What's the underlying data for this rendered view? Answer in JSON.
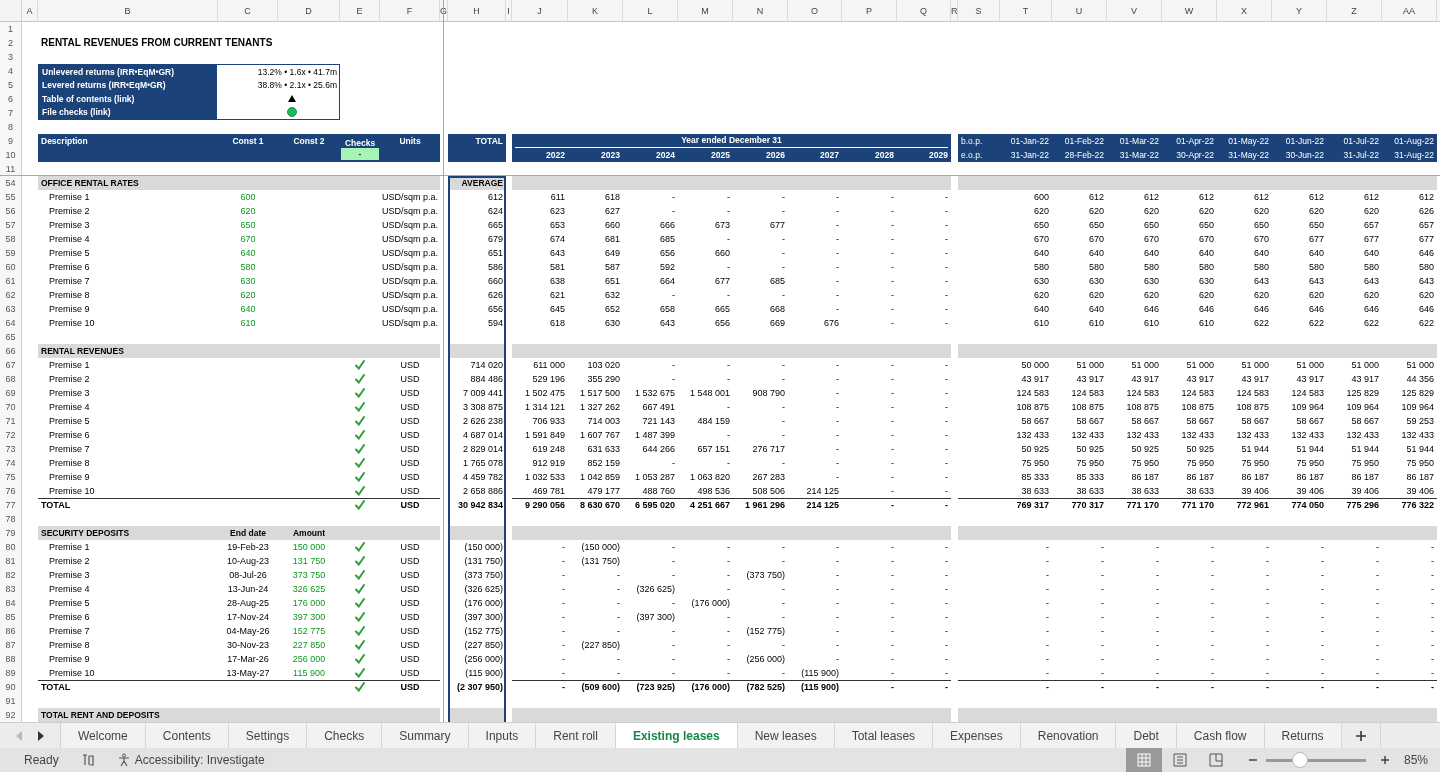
{
  "column_headers": [
    "A",
    "B",
    "C",
    "D",
    "E",
    "F",
    "G",
    "H",
    "I",
    "J",
    "K",
    "L",
    "M",
    "N",
    "O",
    "P",
    "Q",
    "R",
    "S",
    "T",
    "U",
    "V",
    "W",
    "X",
    "Y",
    "Z",
    "AA"
  ],
  "row_numbers": [
    "1",
    "2",
    "3",
    "4",
    "5",
    "6",
    "7",
    "8",
    "9",
    "10",
    "11",
    "54",
    "55",
    "56",
    "57",
    "58",
    "59",
    "60",
    "61",
    "62",
    "63",
    "64",
    "65",
    "66",
    "67",
    "68",
    "69",
    "70",
    "71",
    "72",
    "73",
    "74",
    "75",
    "76",
    "77",
    "78",
    "79",
    "80",
    "81",
    "82",
    "83",
    "84",
    "85",
    "86",
    "87",
    "88",
    "89",
    "90",
    "91",
    "92"
  ],
  "title": "RENTAL REVENUES FROM CURRENT TENANTS",
  "summary_box": [
    {
      "label": "Unlevered returns (IRR•EqM•GR)",
      "kind": "text",
      "value": "13.2% • 1.6x • 41.7m"
    },
    {
      "label": "Levered returns (IRR•EqM•GR)",
      "kind": "text",
      "value": "38.8% • 2.1x • 25.6m"
    },
    {
      "label": "Table of contents (link)",
      "kind": "link"
    },
    {
      "label": "File checks (link)",
      "kind": "status",
      "color": "#1fb85a"
    }
  ],
  "header": {
    "description": "Description",
    "const_1": "Const 1",
    "const_2": "Const 2",
    "checks": "Checks",
    "checks_value": "-",
    "units": "Units",
    "total": "TOTAL",
    "period_title": "Year ended December 31",
    "years": [
      "2022",
      "2023",
      "2024",
      "2025",
      "2026",
      "2027",
      "2028",
      "2029"
    ],
    "bop_label": "b.o.p.",
    "eop_label": "e.o.p.",
    "bop_dates": [
      "01-Jan-22",
      "01-Feb-22",
      "01-Mar-22",
      "01-Apr-22",
      "01-May-22",
      "01-Jun-22",
      "01-Jul-22",
      "01-Aug-22"
    ],
    "eop_dates": [
      "31-Jan-22",
      "28-Feb-22",
      "31-Mar-22",
      "30-Apr-22",
      "31-May-22",
      "30-Jun-22",
      "31-Jul-22",
      "31-Aug-22"
    ]
  },
  "sections": [
    {
      "title": "OFFICE RENTAL RATES",
      "total_heading": "AVERAGE",
      "rows": [
        {
          "label": "Premise 1",
          "rate": "600",
          "units": "USD/sqm p.a.",
          "total": "612",
          "years": [
            "611",
            "618",
            "-",
            "-",
            "-",
            "-",
            "-",
            "-"
          ],
          "months": [
            "600",
            "612",
            "612",
            "612",
            "612",
            "612",
            "612",
            "612"
          ]
        },
        {
          "label": "Premise 2",
          "rate": "620",
          "units": "USD/sqm p.a.",
          "total": "624",
          "years": [
            "623",
            "627",
            "-",
            "-",
            "-",
            "-",
            "-",
            "-"
          ],
          "months": [
            "620",
            "620",
            "620",
            "620",
            "620",
            "620",
            "620",
            "626"
          ]
        },
        {
          "label": "Premise 3",
          "rate": "650",
          "units": "USD/sqm p.a.",
          "total": "665",
          "years": [
            "653",
            "660",
            "666",
            "673",
            "677",
            "-",
            "-",
            "-"
          ],
          "months": [
            "650",
            "650",
            "650",
            "650",
            "650",
            "650",
            "657",
            "657"
          ]
        },
        {
          "label": "Premise 4",
          "rate": "670",
          "units": "USD/sqm p.a.",
          "total": "679",
          "years": [
            "674",
            "681",
            "685",
            "-",
            "-",
            "-",
            "-",
            "-"
          ],
          "months": [
            "670",
            "670",
            "670",
            "670",
            "670",
            "677",
            "677",
            "677"
          ]
        },
        {
          "label": "Premise 5",
          "rate": "640",
          "units": "USD/sqm p.a.",
          "total": "651",
          "years": [
            "643",
            "649",
            "656",
            "660",
            "-",
            "-",
            "-",
            "-"
          ],
          "months": [
            "640",
            "640",
            "640",
            "640",
            "640",
            "640",
            "640",
            "646"
          ]
        },
        {
          "label": "Premise 6",
          "rate": "580",
          "units": "USD/sqm p.a.",
          "total": "586",
          "years": [
            "581",
            "587",
            "592",
            "-",
            "-",
            "-",
            "-",
            "-"
          ],
          "months": [
            "580",
            "580",
            "580",
            "580",
            "580",
            "580",
            "580",
            "580"
          ]
        },
        {
          "label": "Premise 7",
          "rate": "630",
          "units": "USD/sqm p.a.",
          "total": "660",
          "years": [
            "638",
            "651",
            "664",
            "677",
            "685",
            "-",
            "-",
            "-"
          ],
          "months": [
            "630",
            "630",
            "630",
            "630",
            "643",
            "643",
            "643",
            "643"
          ]
        },
        {
          "label": "Premise 8",
          "rate": "620",
          "units": "USD/sqm p.a.",
          "total": "626",
          "years": [
            "621",
            "632",
            "-",
            "-",
            "-",
            "-",
            "-",
            "-"
          ],
          "months": [
            "620",
            "620",
            "620",
            "620",
            "620",
            "620",
            "620",
            "620"
          ]
        },
        {
          "label": "Premise 9",
          "rate": "640",
          "units": "USD/sqm p.a.",
          "total": "656",
          "years": [
            "645",
            "652",
            "658",
            "665",
            "668",
            "-",
            "-",
            "-"
          ],
          "months": [
            "640",
            "640",
            "646",
            "646",
            "646",
            "646",
            "646",
            "646"
          ]
        },
        {
          "label": "Premise 10",
          "rate": "610",
          "units": "USD/sqm p.a.",
          "total": "594",
          "years": [
            "618",
            "630",
            "643",
            "656",
            "669",
            "676",
            "-",
            "-"
          ],
          "months": [
            "610",
            "610",
            "610",
            "610",
            "622",
            "622",
            "622",
            "622"
          ]
        }
      ]
    },
    {
      "title": "RENTAL REVENUES",
      "rows": [
        {
          "label": "Premise 1",
          "check": true,
          "units": "USD",
          "total": "714 020",
          "years": [
            "611 000",
            "103 020",
            "-",
            "-",
            "-",
            "-",
            "-",
            "-"
          ],
          "months": [
            "50 000",
            "51 000",
            "51 000",
            "51 000",
            "51 000",
            "51 000",
            "51 000",
            "51 000"
          ]
        },
        {
          "label": "Premise 2",
          "check": true,
          "units": "USD",
          "total": "884 486",
          "years": [
            "529 196",
            "355 290",
            "-",
            "-",
            "-",
            "-",
            "-",
            "-"
          ],
          "months": [
            "43 917",
            "43 917",
            "43 917",
            "43 917",
            "43 917",
            "43 917",
            "43 917",
            "44 356"
          ]
        },
        {
          "label": "Premise 3",
          "check": true,
          "units": "USD",
          "total": "7 009 441",
          "years": [
            "1 502 475",
            "1 517 500",
            "1 532 675",
            "1 548 001",
            "908 790",
            "-",
            "-",
            "-"
          ],
          "months": [
            "124 583",
            "124 583",
            "124 583",
            "124 583",
            "124 583",
            "124 583",
            "125 829",
            "125 829"
          ]
        },
        {
          "label": "Premise 4",
          "check": true,
          "units": "USD",
          "total": "3 308 875",
          "years": [
            "1 314 121",
            "1 327 262",
            "667 491",
            "-",
            "-",
            "-",
            "-",
            "-"
          ],
          "months": [
            "108 875",
            "108 875",
            "108 875",
            "108 875",
            "108 875",
            "109 964",
            "109 964",
            "109 964"
          ]
        },
        {
          "label": "Premise 5",
          "check": true,
          "units": "USD",
          "total": "2 626 238",
          "years": [
            "706 933",
            "714 003",
            "721 143",
            "484 159",
            "-",
            "-",
            "-",
            "-"
          ],
          "months": [
            "58 667",
            "58 667",
            "58 667",
            "58 667",
            "58 667",
            "58 667",
            "58 667",
            "59 253"
          ]
        },
        {
          "label": "Premise 6",
          "check": true,
          "units": "USD",
          "total": "4 687 014",
          "years": [
            "1 591 849",
            "1 607 767",
            "1 487 399",
            "-",
            "-",
            "-",
            "-",
            "-"
          ],
          "months": [
            "132 433",
            "132 433",
            "132 433",
            "132 433",
            "132 433",
            "132 433",
            "132 433",
            "132 433"
          ]
        },
        {
          "label": "Premise 7",
          "check": true,
          "units": "USD",
          "total": "2 829 014",
          "years": [
            "619 248",
            "631 633",
            "644 266",
            "657 151",
            "276 717",
            "-",
            "-",
            "-"
          ],
          "months": [
            "50 925",
            "50 925",
            "50 925",
            "50 925",
            "51 944",
            "51 944",
            "51 944",
            "51 944"
          ]
        },
        {
          "label": "Premise 8",
          "check": true,
          "units": "USD",
          "total": "1 765 078",
          "years": [
            "912 919",
            "852 159",
            "-",
            "-",
            "-",
            "-",
            "-",
            "-"
          ],
          "months": [
            "75 950",
            "75 950",
            "75 950",
            "75 950",
            "75 950",
            "75 950",
            "75 950",
            "75 950"
          ]
        },
        {
          "label": "Premise 9",
          "check": true,
          "units": "USD",
          "total": "4 459 782",
          "years": [
            "1 032 533",
            "1 042 859",
            "1 053 287",
            "1 063 820",
            "267 283",
            "-",
            "-",
            "-"
          ],
          "months": [
            "85 333",
            "85 333",
            "86 187",
            "86 187",
            "86 187",
            "86 187",
            "86 187",
            "86 187"
          ]
        },
        {
          "label": "Premise 10",
          "check": true,
          "units": "USD",
          "total": "2 658 886",
          "years": [
            "469 781",
            "479 177",
            "488 760",
            "498 536",
            "508 506",
            "214 125",
            "-",
            "-"
          ],
          "months": [
            "38 633",
            "38 633",
            "38 633",
            "38 633",
            "39 406",
            "39 406",
            "39 406",
            "39 406"
          ]
        }
      ],
      "total_row": {
        "label": "TOTAL",
        "check": true,
        "units": "USD",
        "total": "30 942 834",
        "years": [
          "9 290 056",
          "8 630 670",
          "6 595 020",
          "4 251 667",
          "1 961 296",
          "214 125",
          "-",
          "-"
        ],
        "months": [
          "769 317",
          "770 317",
          "771 170",
          "771 170",
          "772 961",
          "774 050",
          "775 296",
          "776 322"
        ]
      }
    },
    {
      "title": "SECURITY DEPOSITS",
      "column_headings": [
        "End date",
        "Amount"
      ],
      "rows": [
        {
          "label": "Premise 1",
          "end_date": "19-Feb-23",
          "amount": "150 000",
          "check": true,
          "units": "USD",
          "total": "(150 000)",
          "years": [
            "-",
            "(150 000)",
            "-",
            "-",
            "-",
            "-",
            "-",
            "-"
          ],
          "months": [
            "-",
            "-",
            "-",
            "-",
            "-",
            "-",
            "-",
            "-"
          ]
        },
        {
          "label": "Premise 2",
          "end_date": "10-Aug-23",
          "amount": "131 750",
          "check": true,
          "units": "USD",
          "total": "(131 750)",
          "years": [
            "-",
            "(131 750)",
            "-",
            "-",
            "-",
            "-",
            "-",
            "-"
          ],
          "months": [
            "-",
            "-",
            "-",
            "-",
            "-",
            "-",
            "-",
            "-"
          ]
        },
        {
          "label": "Premise 3",
          "end_date": "08-Jul-26",
          "amount": "373 750",
          "check": true,
          "units": "USD",
          "total": "(373 750)",
          "years": [
            "-",
            "-",
            "-",
            "-",
            "(373 750)",
            "-",
            "-",
            "-"
          ],
          "months": [
            "-",
            "-",
            "-",
            "-",
            "-",
            "-",
            "-",
            "-"
          ]
        },
        {
          "label": "Premise 4",
          "end_date": "13-Jun-24",
          "amount": "326 625",
          "check": true,
          "units": "USD",
          "total": "(326 625)",
          "years": [
            "-",
            "-",
            "(326 625)",
            "-",
            "-",
            "-",
            "-",
            "-"
          ],
          "months": [
            "-",
            "-",
            "-",
            "-",
            "-",
            "-",
            "-",
            "-"
          ]
        },
        {
          "label": "Premise 5",
          "end_date": "28-Aug-25",
          "amount": "176 000",
          "check": true,
          "units": "USD",
          "total": "(176 000)",
          "years": [
            "-",
            "-",
            "-",
            "(176 000)",
            "-",
            "-",
            "-",
            "-"
          ],
          "months": [
            "-",
            "-",
            "-",
            "-",
            "-",
            "-",
            "-",
            "-"
          ]
        },
        {
          "label": "Premise 6",
          "end_date": "17-Nov-24",
          "amount": "397 300",
          "check": true,
          "units": "USD",
          "total": "(397 300)",
          "years": [
            "-",
            "-",
            "(397 300)",
            "-",
            "-",
            "-",
            "-",
            "-"
          ],
          "months": [
            "-",
            "-",
            "-",
            "-",
            "-",
            "-",
            "-",
            "-"
          ]
        },
        {
          "label": "Premise 7",
          "end_date": "04-May-26",
          "amount": "152 775",
          "check": true,
          "units": "USD",
          "total": "(152 775)",
          "years": [
            "-",
            "-",
            "-",
            "-",
            "(152 775)",
            "-",
            "-",
            "-"
          ],
          "months": [
            "-",
            "-",
            "-",
            "-",
            "-",
            "-",
            "-",
            "-"
          ]
        },
        {
          "label": "Premise 8",
          "end_date": "30-Nov-23",
          "amount": "227 850",
          "check": true,
          "units": "USD",
          "total": "(227 850)",
          "years": [
            "-",
            "(227 850)",
            "-",
            "-",
            "-",
            "-",
            "-",
            "-"
          ],
          "months": [
            "-",
            "-",
            "-",
            "-",
            "-",
            "-",
            "-",
            "-"
          ]
        },
        {
          "label": "Premise 9",
          "end_date": "17-Mar-26",
          "amount": "256 000",
          "check": true,
          "units": "USD",
          "total": "(256 000)",
          "years": [
            "-",
            "-",
            "-",
            "-",
            "(256 000)",
            "-",
            "-",
            "-"
          ],
          "months": [
            "-",
            "-",
            "-",
            "-",
            "-",
            "-",
            "-",
            "-"
          ]
        },
        {
          "label": "Premise 10",
          "end_date": "13-May-27",
          "amount": "115 900",
          "check": true,
          "units": "USD",
          "total": "(115 900)",
          "years": [
            "-",
            "-",
            "-",
            "-",
            "-",
            "(115 900)",
            "-",
            "-"
          ],
          "months": [
            "-",
            "-",
            "-",
            "-",
            "-",
            "-",
            "-",
            "-"
          ]
        }
      ],
      "total_row": {
        "label": "TOTAL",
        "check": true,
        "units": "USD",
        "total": "(2 307 950)",
        "years": [
          "-",
          "(509 600)",
          "(723 925)",
          "(176 000)",
          "(782 525)",
          "(115 900)",
          "-",
          "-"
        ],
        "months": [
          "-",
          "-",
          "-",
          "-",
          "-",
          "-",
          "-",
          "-"
        ]
      }
    },
    {
      "title": "TOTAL RENT AND DEPOSITS"
    }
  ],
  "sheet_tabs": [
    {
      "label": "Welcome",
      "selected": false
    },
    {
      "label": "Contents",
      "selected": false
    },
    {
      "label": "Settings",
      "selected": false
    },
    {
      "label": "Checks",
      "selected": false
    },
    {
      "label": "Summary",
      "selected": false
    },
    {
      "label": "Inputs",
      "selected": false
    },
    {
      "label": "Rent roll",
      "selected": false
    },
    {
      "label": "Existing leases",
      "selected": true
    },
    {
      "label": "New leases",
      "selected": false
    },
    {
      "label": "Total leases",
      "selected": false
    },
    {
      "label": "Expenses",
      "selected": false
    },
    {
      "label": "Renovation",
      "selected": false
    },
    {
      "label": "Debt",
      "selected": false
    },
    {
      "label": "Cash flow",
      "selected": false
    },
    {
      "label": "Returns",
      "selected": false
    }
  ],
  "status_bar": {
    "mode": "Ready",
    "accessibility": "Accessibility: Investigate",
    "view_modes": [
      {
        "kind": "normal",
        "selected": true
      },
      {
        "kind": "page_layout",
        "selected": false
      },
      {
        "kind": "page_break",
        "selected": false
      }
    ],
    "zoom": {
      "level": 0.34,
      "reading": "85%"
    }
  }
}
